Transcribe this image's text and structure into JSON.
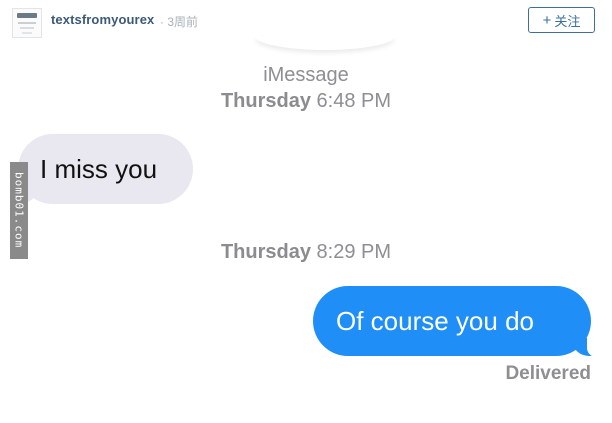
{
  "post_header": {
    "username": "textsfromyourex",
    "timestamp": "· 3周前",
    "follow_button_icon": "plus-icon",
    "follow_button_plus": "+",
    "follow_button_label": "关注",
    "accent_color": "#3c6ea0"
  },
  "conversation": {
    "service": "iMessage",
    "first_time": {
      "day": "Thursday",
      "time": "6:48 PM"
    },
    "received_message": "I miss you",
    "second_time": {
      "day": "Thursday",
      "time": "8:29 PM"
    },
    "sent_message": "Of course you do",
    "sent_status": "Delivered",
    "received_bubble_color": "#e9e7ef",
    "sent_bubble_color": "#1f8ef6"
  },
  "watermark": "bomb01.com"
}
